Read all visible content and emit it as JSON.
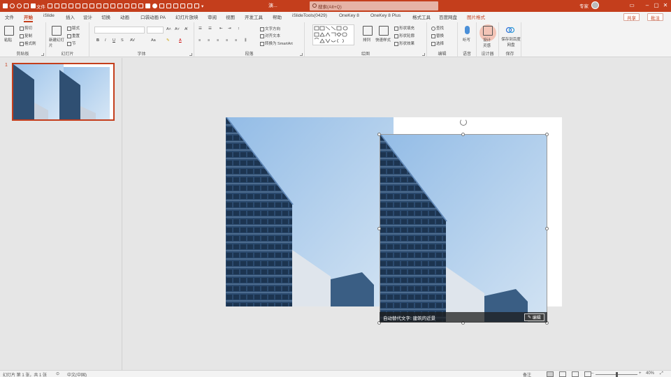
{
  "titlebar": {
    "qat": [
      "",
      "",
      "",
      "",
      "文件",
      "",
      "",
      "",
      "",
      "",
      "",
      ""
    ],
    "doc_name": "演...",
    "search_placeholder": "搜索(Alt+Q)",
    "user": "专家",
    "bg_color": "#c43e1c"
  },
  "tabs": {
    "items": [
      "文件",
      "开始",
      "iSlide",
      "插入",
      "设计",
      "切换",
      "动画",
      "口袋动画 PA",
      "幻灯片放映",
      "审阅",
      "视图",
      "开发工具",
      "帮助",
      "iSlideTools(0429)",
      "OneKey 8",
      "OneKey 8 Plus",
      "格式工具",
      "百度网盘",
      "图片格式"
    ],
    "active": "开始",
    "contextual": "图片格式",
    "share": "共享",
    "comment": "批注"
  },
  "ribbon": {
    "clipboard": {
      "label": "剪贴板",
      "paste": "粘贴",
      "cut": "剪切",
      "copy": "复制",
      "format_painter": "格式刷"
    },
    "slides": {
      "label": "幻灯片",
      "new_slide": "新建幻灯片",
      "layout": "版式",
      "reset": "重置",
      "section": "节"
    },
    "font": {
      "label": "字体",
      "font_name": "",
      "font_size": "",
      "bold": "B",
      "italic": "I",
      "underline": "U",
      "strike": "S",
      "char_spacing": "AV",
      "case": "Aa"
    },
    "paragraph": {
      "label": "段落",
      "text_direction": "文字方向",
      "align_text": "对齐文本",
      "smartart": "转换为 SmartArt"
    },
    "drawing": {
      "label": "绘图",
      "arrange": "排列",
      "quick_styles": "快速样式",
      "shape_fill": "形状填充",
      "shape_outline": "形状轮廓",
      "shape_effects": "形状效果"
    },
    "editing": {
      "label": "编辑",
      "find": "查找",
      "replace": "替换",
      "select": "选择"
    },
    "voice": {
      "label": "语音",
      "dictate": "听写"
    },
    "designer": {
      "label": "设计器",
      "design_ideas": "设计灵感"
    },
    "save": {
      "label": "保存",
      "save_to_baidu": "保存到百度网盘"
    }
  },
  "thumbnails": [
    {
      "number": "1"
    }
  ],
  "slide": {
    "alt_text": "自动替代文字: 建筑的近景",
    "edit_button": "编辑"
  },
  "statusbar": {
    "slide_info": "幻灯片 第 1 张，共 1 张",
    "language": "中文(中国)",
    "notes": "备注",
    "zoom": "40%"
  }
}
